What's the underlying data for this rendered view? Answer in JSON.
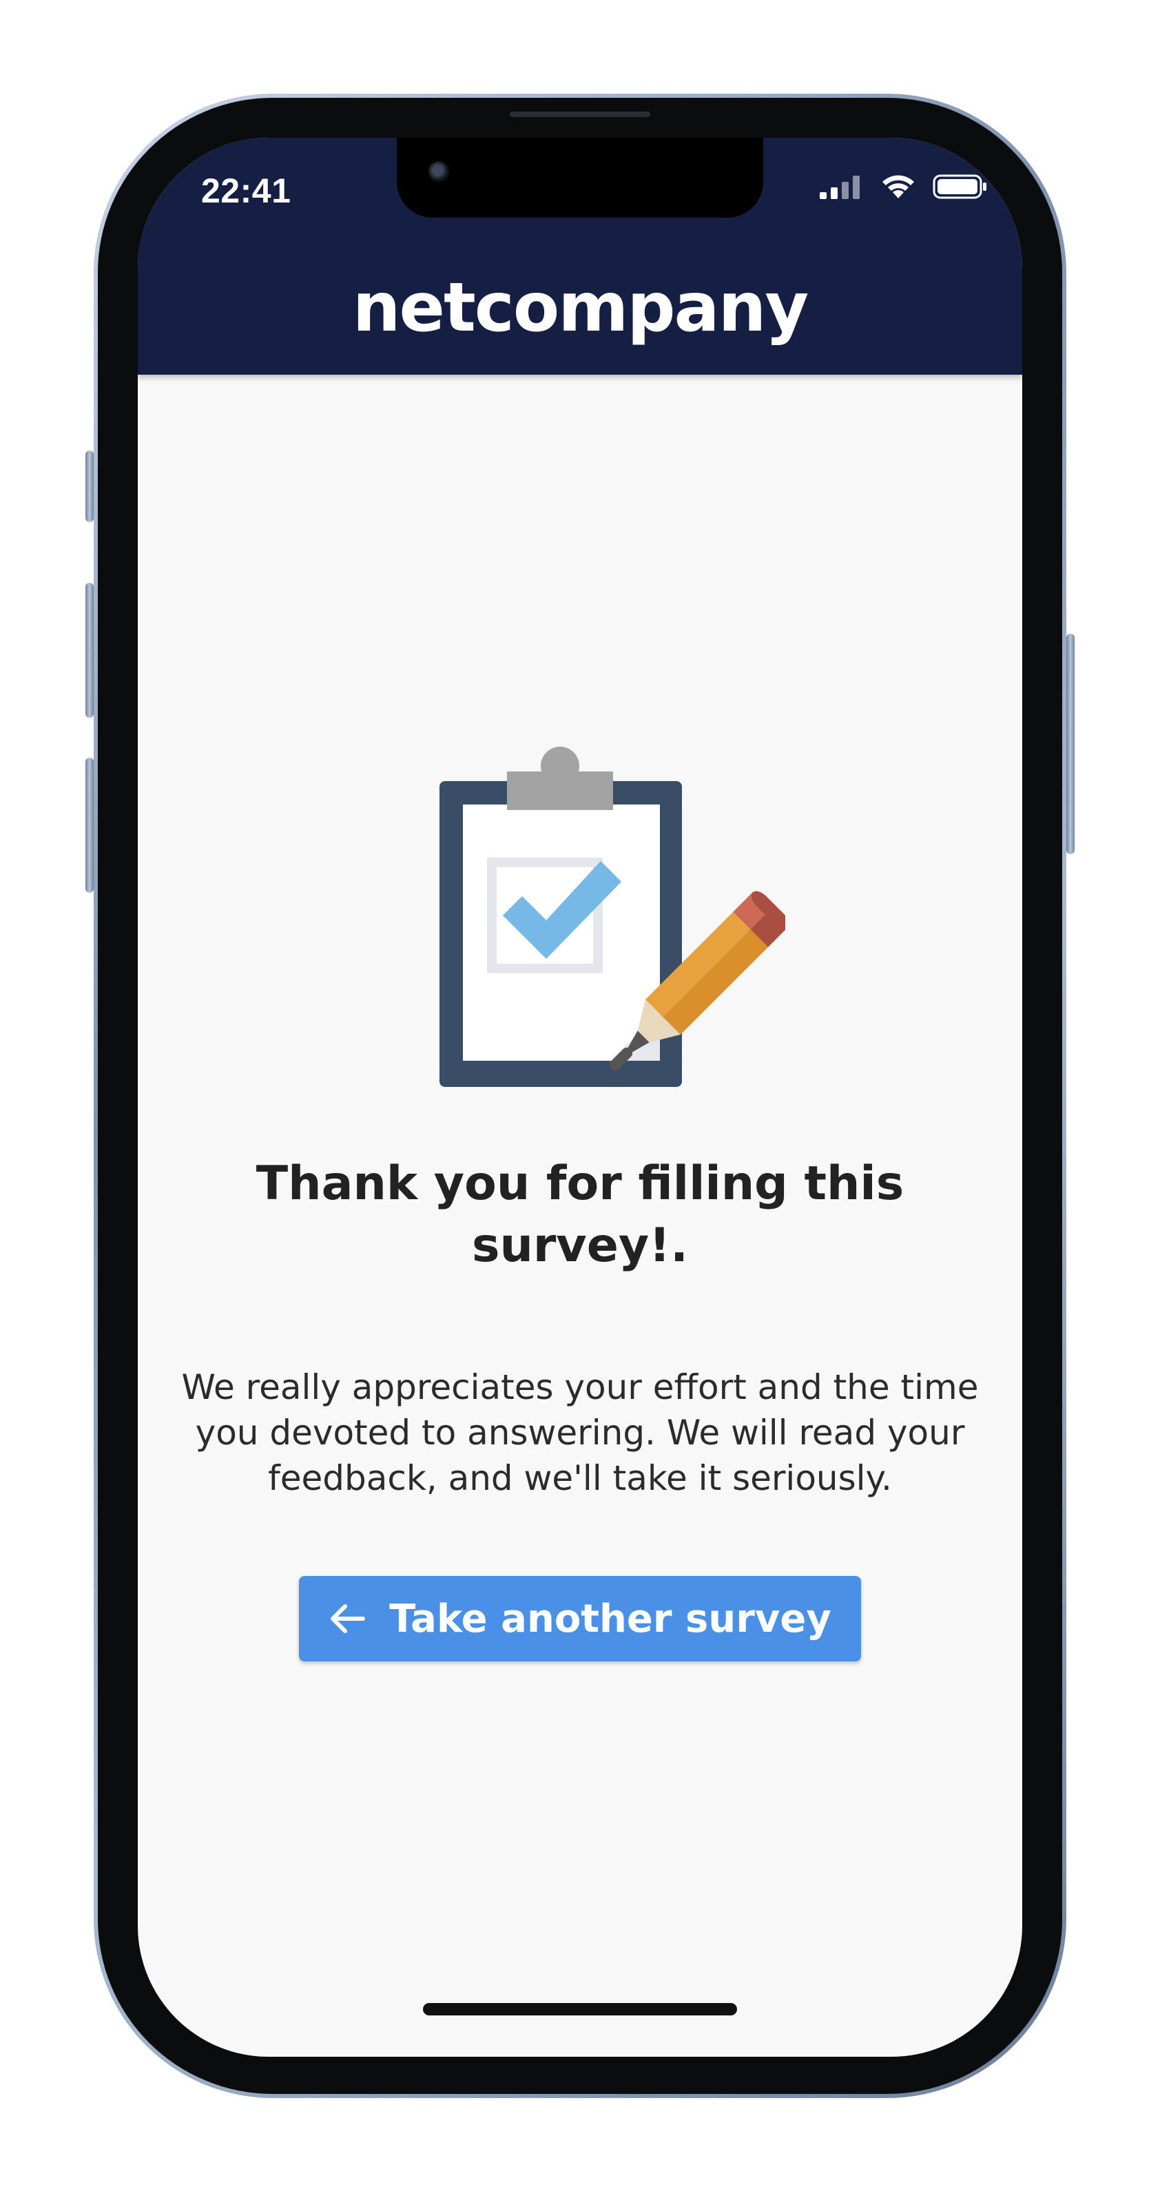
{
  "status_bar": {
    "time": "22:41",
    "icons": [
      "cellular-signal-icon",
      "wifi-icon",
      "battery-icon"
    ]
  },
  "header": {
    "brand": "netcompany",
    "background_color": "#141f43"
  },
  "illustration": {
    "icon": "clipboard-checkmark-pencil-icon"
  },
  "main": {
    "title": "Thank you for filling this survey!.",
    "body": "We really appreciates your effort and the time you devoted to answering. We will read your feedback, and we'll take it seriously."
  },
  "cta": {
    "label": "Take another survey",
    "icon": "arrow-left-icon",
    "color": "#4a90e6"
  }
}
